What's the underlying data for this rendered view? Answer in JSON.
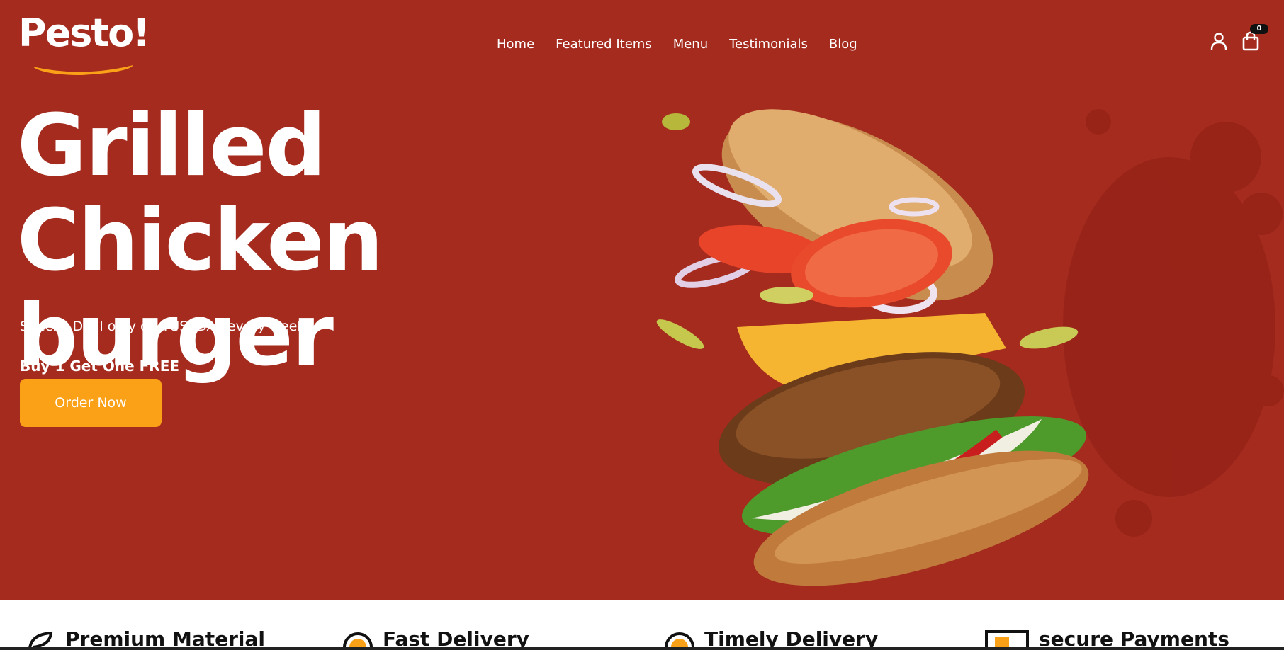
{
  "brand": {
    "name": "Pesto!",
    "accent_color": "#fba117",
    "hero_color": "#a42b1e"
  },
  "nav": {
    "items": [
      {
        "label": "Home"
      },
      {
        "label": "Featured Items"
      },
      {
        "label": "Menu"
      },
      {
        "label": "Testimonials"
      },
      {
        "label": "Blog"
      }
    ]
  },
  "header_icons": {
    "account_icon": "user-icon",
    "cart_icon": "shopping-bag-icon",
    "cart_count": "0"
  },
  "hero": {
    "headline_line1": "Grilled Chicken",
    "headline_line2": "burger",
    "deal_text": "Special Deal only on TUSEDAY every week",
    "offer_text": "Buy 1 Get One FREE",
    "cta_label": "Order Now",
    "image": "flying-burger-image"
  },
  "features": [
    {
      "icon": "leaf-icon",
      "label": "Premium Material"
    },
    {
      "icon": "clock-icon",
      "label": "Fast Delivery"
    },
    {
      "icon": "timer-icon",
      "label": "Timely Delivery"
    },
    {
      "icon": "payment-icon",
      "label": "secure Payments"
    }
  ]
}
